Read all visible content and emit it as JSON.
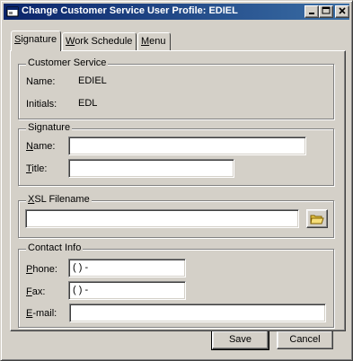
{
  "window": {
    "title": "Change Customer Service User Profile: EDIEL"
  },
  "tabs": [
    {
      "accel": "S",
      "rest": "ignature"
    },
    {
      "accel": "W",
      "rest": "ork Schedule"
    },
    {
      "accel": "M",
      "rest": "enu"
    }
  ],
  "customer_service": {
    "legend": "Customer Service",
    "name_label": "Name:",
    "name_value": "EDIEL",
    "initials_label": "Initials:",
    "initials_value": "EDL"
  },
  "signature": {
    "legend": "Signature",
    "name_accel": "N",
    "name_rest": "ame:",
    "name_value": "",
    "title_accel": "T",
    "title_rest": "itle:",
    "title_value": ""
  },
  "xsl": {
    "legend_accel": "X",
    "legend_rest": "SL Filename",
    "value": ""
  },
  "contact": {
    "legend": "Contact Info",
    "phone_accel": "P",
    "phone_rest": "hone:",
    "phone_value": "(   )    -",
    "fax_accel": "F",
    "fax_rest": "ax:",
    "fax_value": "(   )    -",
    "email_accel": "E",
    "email_rest": "-mail:",
    "email_value": ""
  },
  "buttons": {
    "save": "Save",
    "cancel": "Cancel"
  },
  "icons": {
    "app": "app-window-icon",
    "minimize": "minimize-icon",
    "maximize": "maximize-icon",
    "close": "close-icon",
    "browse": "folder-icon"
  }
}
